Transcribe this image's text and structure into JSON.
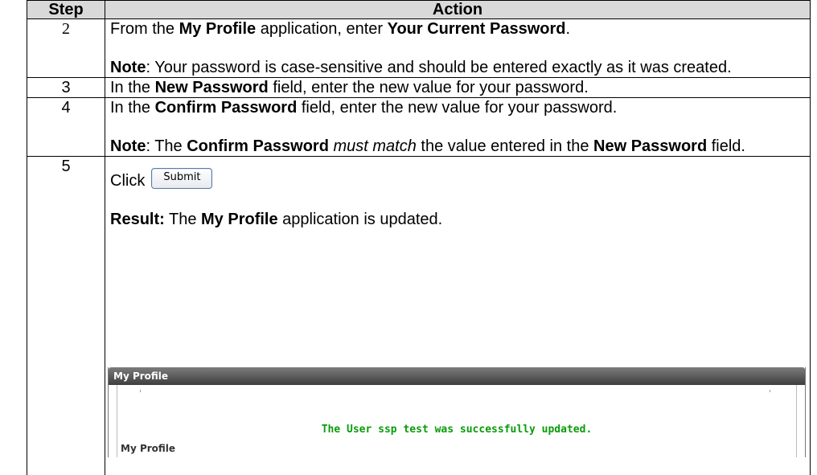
{
  "table": {
    "headers": [
      "Step",
      "Action"
    ],
    "rows": {
      "r2": {
        "step": "2",
        "p1": [
          "From the ",
          "My Profile",
          " application, enter ",
          "Your Current Password",
          "."
        ],
        "p2": [
          "Note",
          ":  Your password is case-sensitive and should be entered exactly as it was created."
        ]
      },
      "r3": {
        "step": "3",
        "p1": [
          "In the ",
          "New Password",
          " field, enter the new value for your password."
        ]
      },
      "r4": {
        "step": "4",
        "p1": [
          "In the ",
          "Confirm Password",
          " field, enter the new value for your password."
        ],
        "p2": [
          "Note",
          ": The ",
          "Confirm Password",
          " ",
          "must match",
          " the value entered in the ",
          "New Password",
          " field."
        ]
      },
      "r5": {
        "step": "5",
        "click_label": "Click",
        "submit_button": "Submit",
        "result": [
          "Result:",
          "  The ",
          "My Profile",
          " application is updated."
        ]
      }
    }
  },
  "profile_panel": {
    "header": "My Profile",
    "message": "The User ssp test was successfully updated.",
    "subheading": "My Profile",
    "message_color": "#0a9b0a"
  }
}
